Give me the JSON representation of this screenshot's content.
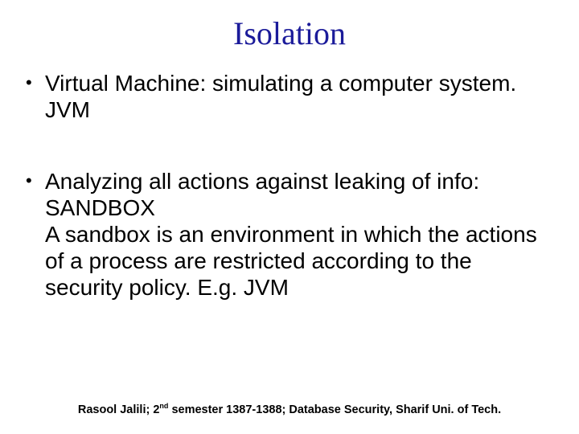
{
  "title": "Isolation",
  "bullets": [
    {
      "text": "Virtual Machine:  simulating a computer system. JVM"
    },
    {
      "text": "Analyzing all actions against leaking of info: SANDBOX",
      "extra": "A sandbox is an environment in which the actions of a process are restricted according to the security policy.  E.g. JVM"
    }
  ],
  "footer": {
    "author": "Rasool Jalili; ",
    "ord": "2",
    "sup": "nd",
    "rest": " semester 1387-1388; Database Security, Sharif Uni. of Tech."
  }
}
